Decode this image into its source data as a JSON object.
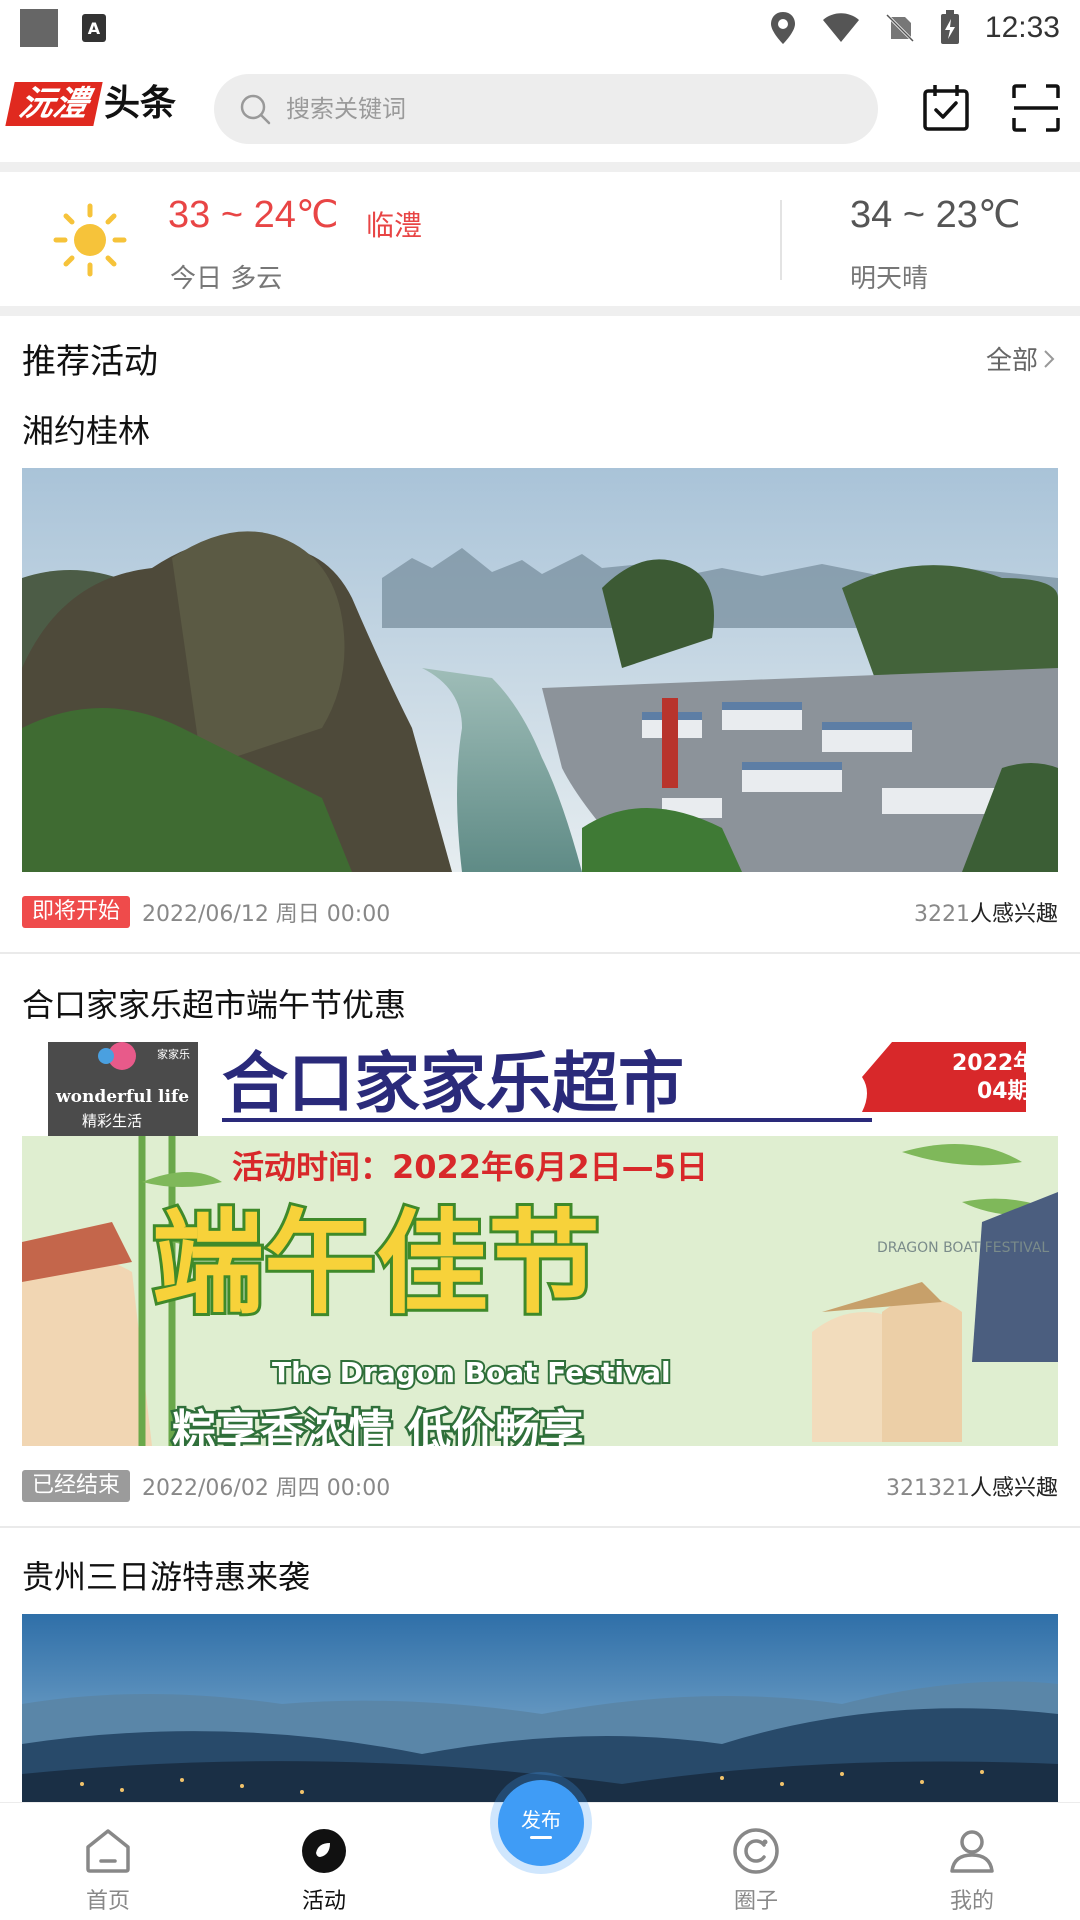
{
  "status_bar": {
    "time": "12:33"
  },
  "header": {
    "logo_red": "沅澧",
    "logo_black": "头条",
    "search_placeholder": "搜索关键词"
  },
  "weather": {
    "today_temp": "33 ~ 24℃",
    "city": "临澧",
    "today_desc": "今日 多云",
    "tomorrow_temp": "34 ~ 23℃",
    "tomorrow_desc": "明天晴"
  },
  "section": {
    "title": "推荐活动",
    "all_label": "全部"
  },
  "activities": [
    {
      "title": "湘约桂林",
      "badge": "即将开始",
      "badge_color": "#ef4b4b",
      "date": "2022/06/12 周日 00:00",
      "count": "3221",
      "interest_suffix": "人感兴趣"
    },
    {
      "title": "合口家家乐超市端午节优惠",
      "badge": "已经结束",
      "badge_color": "#9b9b9b",
      "date": "2022/06/02 周四 00:00",
      "count": "321321",
      "interest_suffix": "人感兴趣",
      "banner": {
        "brand_cn": "家家乐",
        "brand_en": "wonderful life",
        "brand_sub": "精彩生活",
        "store_name": "合口家家乐超市",
        "issue_year": "2022年",
        "issue_no": "04期",
        "period": "活动时间：2022年6月2日—5日",
        "festival_cn": "端午佳节",
        "festival_en": "The Dragon Boat Festival",
        "slogan": "粽享香浓情 低价畅享",
        "side_en": "DRAGON BOAT FESTIVAL"
      }
    },
    {
      "title": "贵州三日游特惠来袭"
    }
  ],
  "bottom_nav": {
    "home": "首页",
    "activity": "活动",
    "publish": "发布",
    "circle": "圈子",
    "mine": "我的"
  },
  "colors": {
    "brand_red": "#e0291f",
    "accent_blue": "#3f9cf6",
    "temp_red": "#e84545"
  }
}
